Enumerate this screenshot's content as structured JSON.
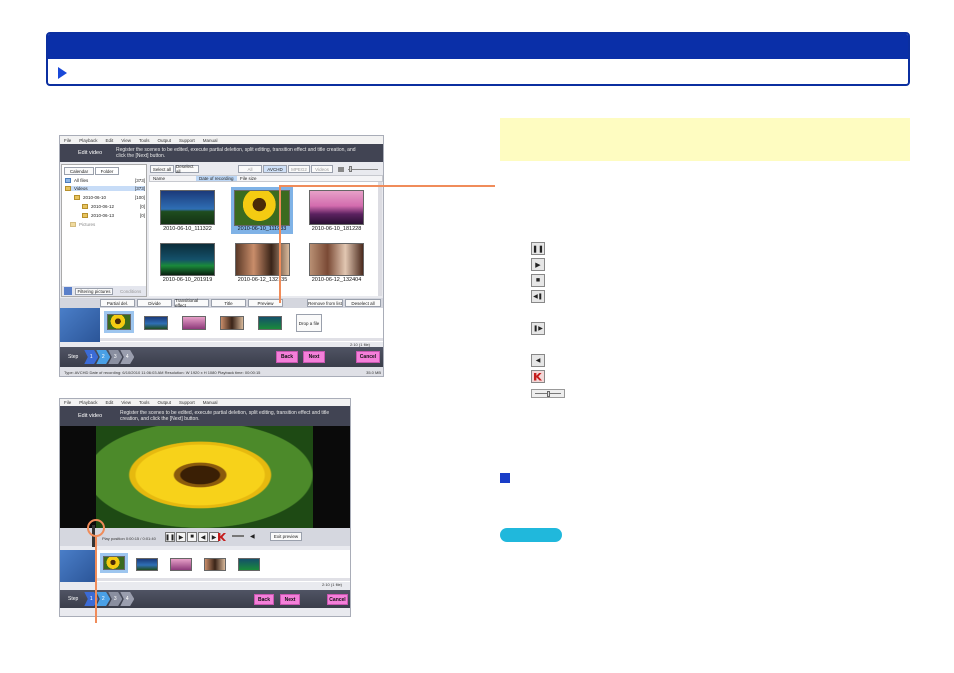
{
  "screenshot1": {
    "menu": [
      "File",
      "Playback",
      "Edit",
      "View",
      "Tools",
      "Output",
      "Support",
      "Manual"
    ],
    "title": "Edit video",
    "instruction": "Register the scenes to be edited, execute partial deletion, split editing, transition effect and title creation, and click the [Next] button.",
    "tabs": {
      "calendar": "Calendar",
      "folder": "Folder"
    },
    "tree": [
      {
        "label": "All files",
        "count": "[373]"
      },
      {
        "label": "Videos",
        "count": "[373]"
      },
      {
        "label": "2010-06-10",
        "count": "[100]"
      },
      {
        "label": "2010-06-12",
        "count": "[0]"
      },
      {
        "label": "2010-06-13",
        "count": "[0]"
      },
      {
        "label": "Pictures",
        "count": ""
      }
    ],
    "select_all": "Select all",
    "deselect_all": "Deselect all",
    "filters": [
      "All",
      "AVCHD",
      "MPEG2",
      "Videos"
    ],
    "columns": {
      "name": "Name",
      "date": "Date of recording",
      "file_size": "File size"
    },
    "thumbs": [
      "2010-06-10_111322",
      "2010-06-10_111933",
      "2010-06-10_181228",
      "2010-06-10_201919",
      "2010-06-12_132135",
      "2010-06-12_132404"
    ],
    "filter_label": "Filtering pictures",
    "conditions": "Conditions",
    "edit_buttons": [
      "Partial del.",
      "Divide",
      "Transitional effect",
      "Title",
      "Preview"
    ],
    "list_buttons": [
      "Remove from list",
      "Deselect all"
    ],
    "drop_label": "Drop a file",
    "duration": "2:10 (1 file)",
    "step_label": "Step",
    "steps": [
      "1",
      "2",
      "3",
      "4"
    ],
    "back": "Back",
    "next": "Next",
    "cancel": "Cancel",
    "status": "Type: AVCHD   Date of recording: 6/10/2010 11:06:03 AM   Resolution: W 1920 x H 1080   Playback time: 00:00:15",
    "size": "35.0 MB"
  },
  "screenshot2": {
    "menu": [
      "File",
      "Playback",
      "Edit",
      "View",
      "Tools",
      "Output",
      "Support",
      "Manual"
    ],
    "title": "Edit video",
    "instruction": "Register the scenes to be edited, execute partial deletion, split editing, transition effect and title creation, and click the [Next] button.",
    "play_position": "Play position",
    "time": "0:00:15 / 0:01:40",
    "exit_preview": "Exit preview",
    "duration": "2:10 (1 file)",
    "step_label": "Step",
    "steps": [
      "1",
      "2",
      "3",
      "4"
    ],
    "back": "Back",
    "next": "Next",
    "cancel": "Cancel"
  },
  "colors": {
    "header": "#0a2fa8",
    "accent": "#f08c5a",
    "note": "#fefcc1",
    "button_pill": "#20b8dc",
    "bullet": "#1a3ec8"
  }
}
